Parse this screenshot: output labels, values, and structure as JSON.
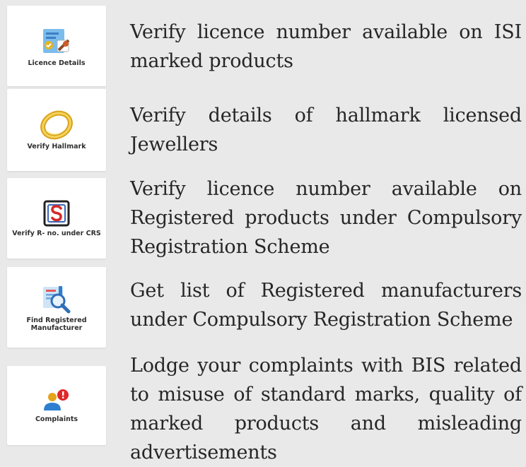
{
  "items": [
    {
      "label": "Licence Details",
      "description": "Verify licence number available on ISI marked products",
      "icon": "licence-certificate-icon"
    },
    {
      "label": "Verify Hallmark",
      "description": "Verify details of hallmark licensed Jewellers",
      "icon": "gold-ring-icon"
    },
    {
      "label": "Verify R- no. under CRS",
      "description": "Verify licence number available on Registered products under Compulsory Registration Scheme",
      "icon": "crs-s-mark-icon"
    },
    {
      "label": "Find Registered Manufacturer",
      "description": "Get list of Registered manufacturers under Compulsory Registration Scheme",
      "icon": "magnifier-document-icon"
    },
    {
      "label": "Complaints",
      "description": "Lodge your complaints with BIS related to misuse of standard marks, quality of marked products and misleading advertisements",
      "icon": "user-alert-icon"
    }
  ],
  "colors": {
    "background": "#e9e9e9",
    "tile": "#ffffff",
    "text": "#262626",
    "accent_blue": "#2f7fd1",
    "accent_red": "#e02828",
    "accent_gold": "#e6b422"
  }
}
